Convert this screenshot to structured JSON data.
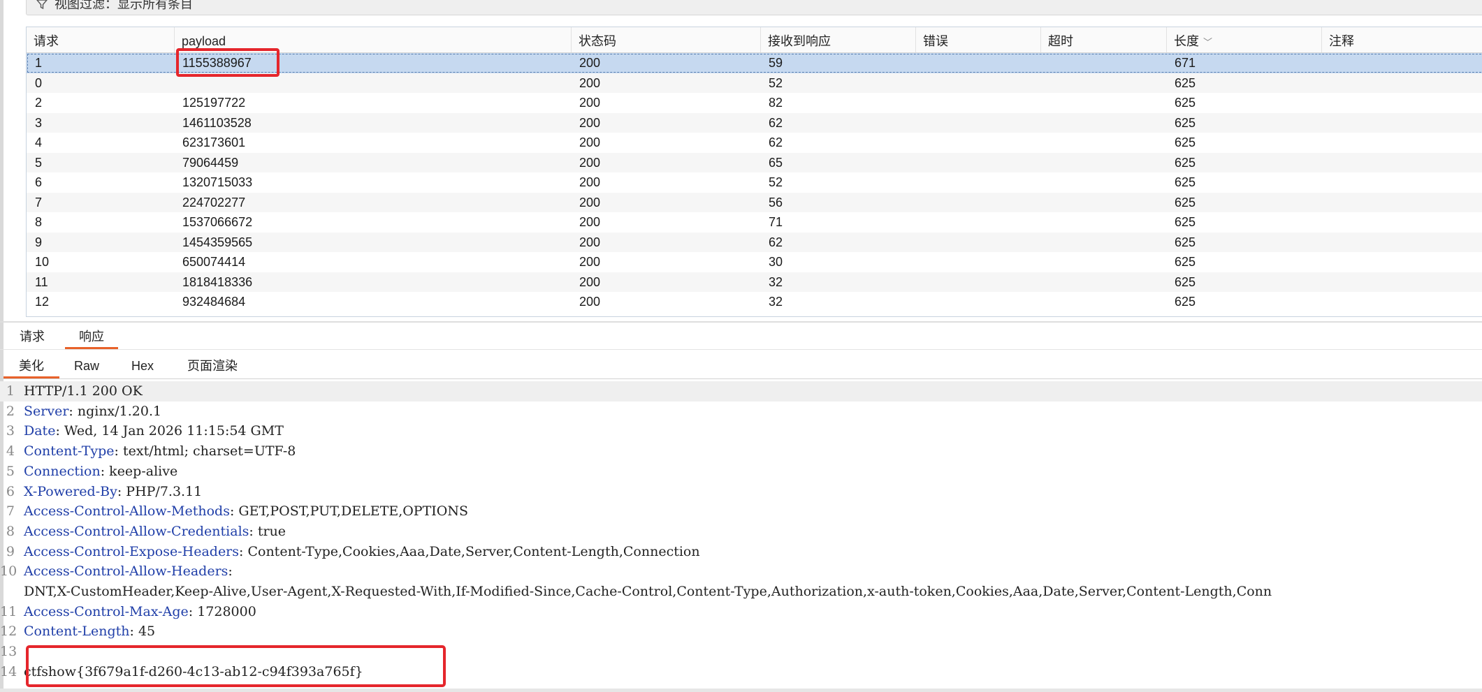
{
  "filter_bar": {
    "label": "视图过滤：显示所有条目"
  },
  "table": {
    "columns": [
      "请求",
      "payload",
      "状态码",
      "接收到响应",
      "错误",
      "超时",
      "长度",
      "注释"
    ],
    "rows": [
      {
        "req": "1",
        "payload": "1155388967",
        "status": "200",
        "resp": "59",
        "error": "",
        "timeout": "",
        "length": "671",
        "comment": "",
        "selected": true
      },
      {
        "req": "0",
        "payload": "",
        "status": "200",
        "resp": "52",
        "error": "",
        "timeout": "",
        "length": "625",
        "comment": ""
      },
      {
        "req": "2",
        "payload": "125197722",
        "status": "200",
        "resp": "82",
        "error": "",
        "timeout": "",
        "length": "625",
        "comment": ""
      },
      {
        "req": "3",
        "payload": "1461103528",
        "status": "200",
        "resp": "62",
        "error": "",
        "timeout": "",
        "length": "625",
        "comment": ""
      },
      {
        "req": "4",
        "payload": "623173601",
        "status": "200",
        "resp": "62",
        "error": "",
        "timeout": "",
        "length": "625",
        "comment": ""
      },
      {
        "req": "5",
        "payload": "79064459",
        "status": "200",
        "resp": "65",
        "error": "",
        "timeout": "",
        "length": "625",
        "comment": ""
      },
      {
        "req": "6",
        "payload": "1320715033",
        "status": "200",
        "resp": "52",
        "error": "",
        "timeout": "",
        "length": "625",
        "comment": ""
      },
      {
        "req": "7",
        "payload": "224702277",
        "status": "200",
        "resp": "56",
        "error": "",
        "timeout": "",
        "length": "625",
        "comment": ""
      },
      {
        "req": "8",
        "payload": "1537066672",
        "status": "200",
        "resp": "71",
        "error": "",
        "timeout": "",
        "length": "625",
        "comment": ""
      },
      {
        "req": "9",
        "payload": "1454359565",
        "status": "200",
        "resp": "62",
        "error": "",
        "timeout": "",
        "length": "625",
        "comment": ""
      },
      {
        "req": "10",
        "payload": "650074414",
        "status": "200",
        "resp": "30",
        "error": "",
        "timeout": "",
        "length": "625",
        "comment": ""
      },
      {
        "req": "11",
        "payload": "1818418336",
        "status": "200",
        "resp": "32",
        "error": "",
        "timeout": "",
        "length": "625",
        "comment": ""
      },
      {
        "req": "12",
        "payload": "932484684",
        "status": "200",
        "resp": "32",
        "error": "",
        "timeout": "",
        "length": "625",
        "comment": ""
      }
    ]
  },
  "panel_tabs": [
    {
      "label": "请求",
      "active": false
    },
    {
      "label": "响应",
      "active": true
    }
  ],
  "view_tabs": [
    {
      "label": "美化",
      "active": true
    },
    {
      "label": "Raw",
      "active": false
    },
    {
      "label": "Hex",
      "active": false
    },
    {
      "label": "页面渲染",
      "active": false
    }
  ],
  "response_lines": [
    {
      "n": "1",
      "k": "",
      "v": "HTTP/1.1 200 OK"
    },
    {
      "n": "2",
      "k": "Server",
      "v": ": nginx/1.20.1"
    },
    {
      "n": "3",
      "k": "Date",
      "v": ": Wed, 14 Jan 2026 11:15:54 GMT"
    },
    {
      "n": "4",
      "k": "Content-Type",
      "v": ": text/html; charset=UTF-8"
    },
    {
      "n": "5",
      "k": "Connection",
      "v": ": keep-alive"
    },
    {
      "n": "6",
      "k": "X-Powered-By",
      "v": ": PHP/7.3.11"
    },
    {
      "n": "7",
      "k": "Access-Control-Allow-Methods",
      "v": ": GET,POST,PUT,DELETE,OPTIONS"
    },
    {
      "n": "8",
      "k": "Access-Control-Allow-Credentials",
      "v": ": true"
    },
    {
      "n": "9",
      "k": "Access-Control-Expose-Headers",
      "v": ": Content-Type,Cookies,Aaa,Date,Server,Content-Length,Connection"
    },
    {
      "n": "10",
      "k": "Access-Control-Allow-Headers",
      "v": ":"
    },
    {
      "n": "",
      "k": "",
      "v": "DNT,X-CustomHeader,Keep-Alive,User-Agent,X-Requested-With,If-Modified-Since,Cache-Control,Content-Type,Authorization,x-auth-token,Cookies,Aaa,Date,Server,Content-Length,Conn"
    },
    {
      "n": "11",
      "k": "Access-Control-Max-Age",
      "v": ": 1728000"
    },
    {
      "n": "12",
      "k": "Content-Length",
      "v": ": 45"
    },
    {
      "n": "13",
      "k": "",
      "v": ""
    },
    {
      "n": "14",
      "k": "",
      "v": "ctfshow{3f679a1f-d260-4c13-ab12-c94f393a765f}"
    }
  ],
  "colors": {
    "selected_row": "#c6d9f0",
    "highlight": "#e5262c",
    "active_tab": "#e8622a",
    "header_key": "#1f3ea8"
  },
  "icons": {
    "filter": "filter-icon",
    "sort": "chevron-down-icon"
  }
}
